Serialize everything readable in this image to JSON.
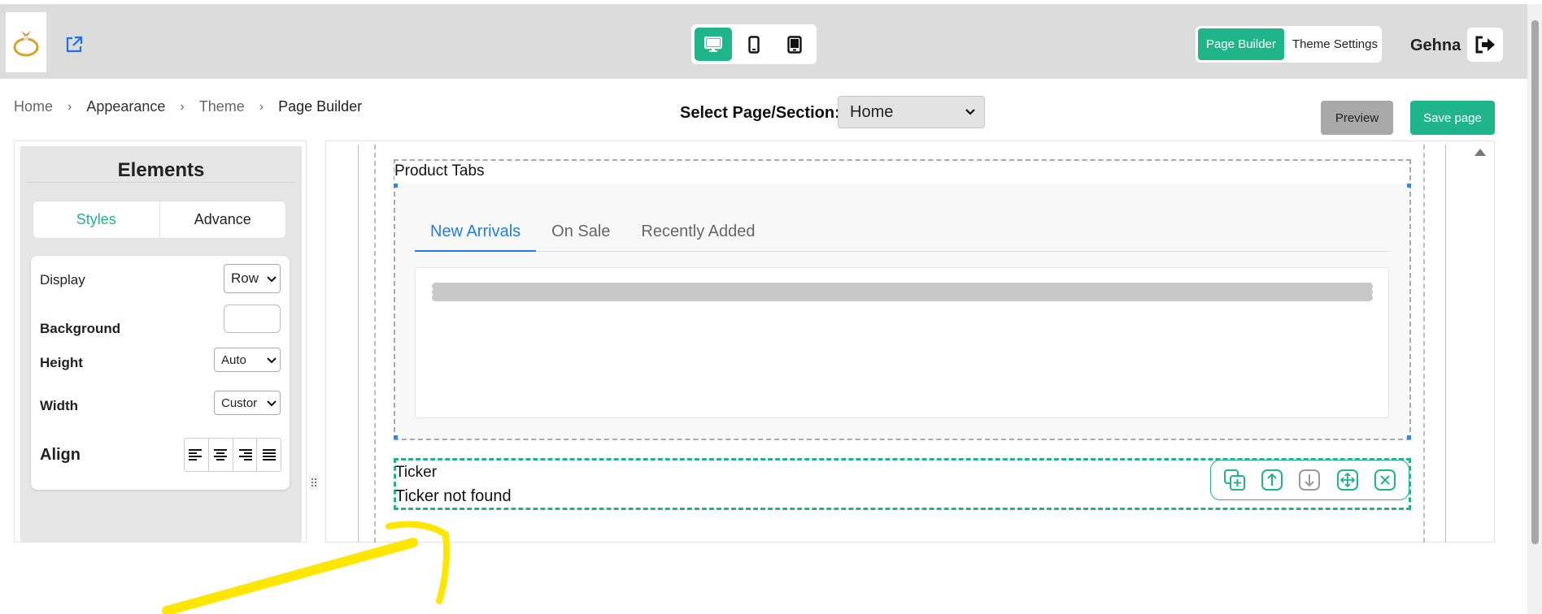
{
  "header": {
    "logo_alt": "ring-logo",
    "username": "Gehna",
    "device_modes": [
      "desktop",
      "mobile",
      "tablet"
    ],
    "active_device": "desktop",
    "mode_buttons": {
      "page_builder": "Page Builder",
      "theme_settings": "Theme Settings"
    }
  },
  "breadcrumb": {
    "items": [
      "Home",
      "Appearance",
      "Theme",
      "Page Builder"
    ]
  },
  "page_select": {
    "label": "Select Page/Section:",
    "value": "Home"
  },
  "actions": {
    "preview": "Preview",
    "save": "Save page"
  },
  "elements_panel": {
    "title": "Elements",
    "tabs": {
      "styles": "Styles",
      "advance": "Advance"
    },
    "display": {
      "label": "Display",
      "value": "Row"
    },
    "background": {
      "label": "Background"
    },
    "height": {
      "label": "Height",
      "value": "Auto"
    },
    "width": {
      "label": "Width",
      "value": "Custor"
    },
    "align": {
      "label": "Align"
    }
  },
  "canvas": {
    "product_tabs": {
      "label": "Product Tabs",
      "tabs": [
        "New Arrivals",
        "On Sale",
        "Recently Added"
      ],
      "active_tab": "New Arrivals"
    },
    "ticker": {
      "label": "Ticker",
      "message": "Ticker not found"
    }
  },
  "colors": {
    "accent": "#20b48a",
    "tab_active": "#1e7fe0",
    "annotation": "#ffe600"
  }
}
